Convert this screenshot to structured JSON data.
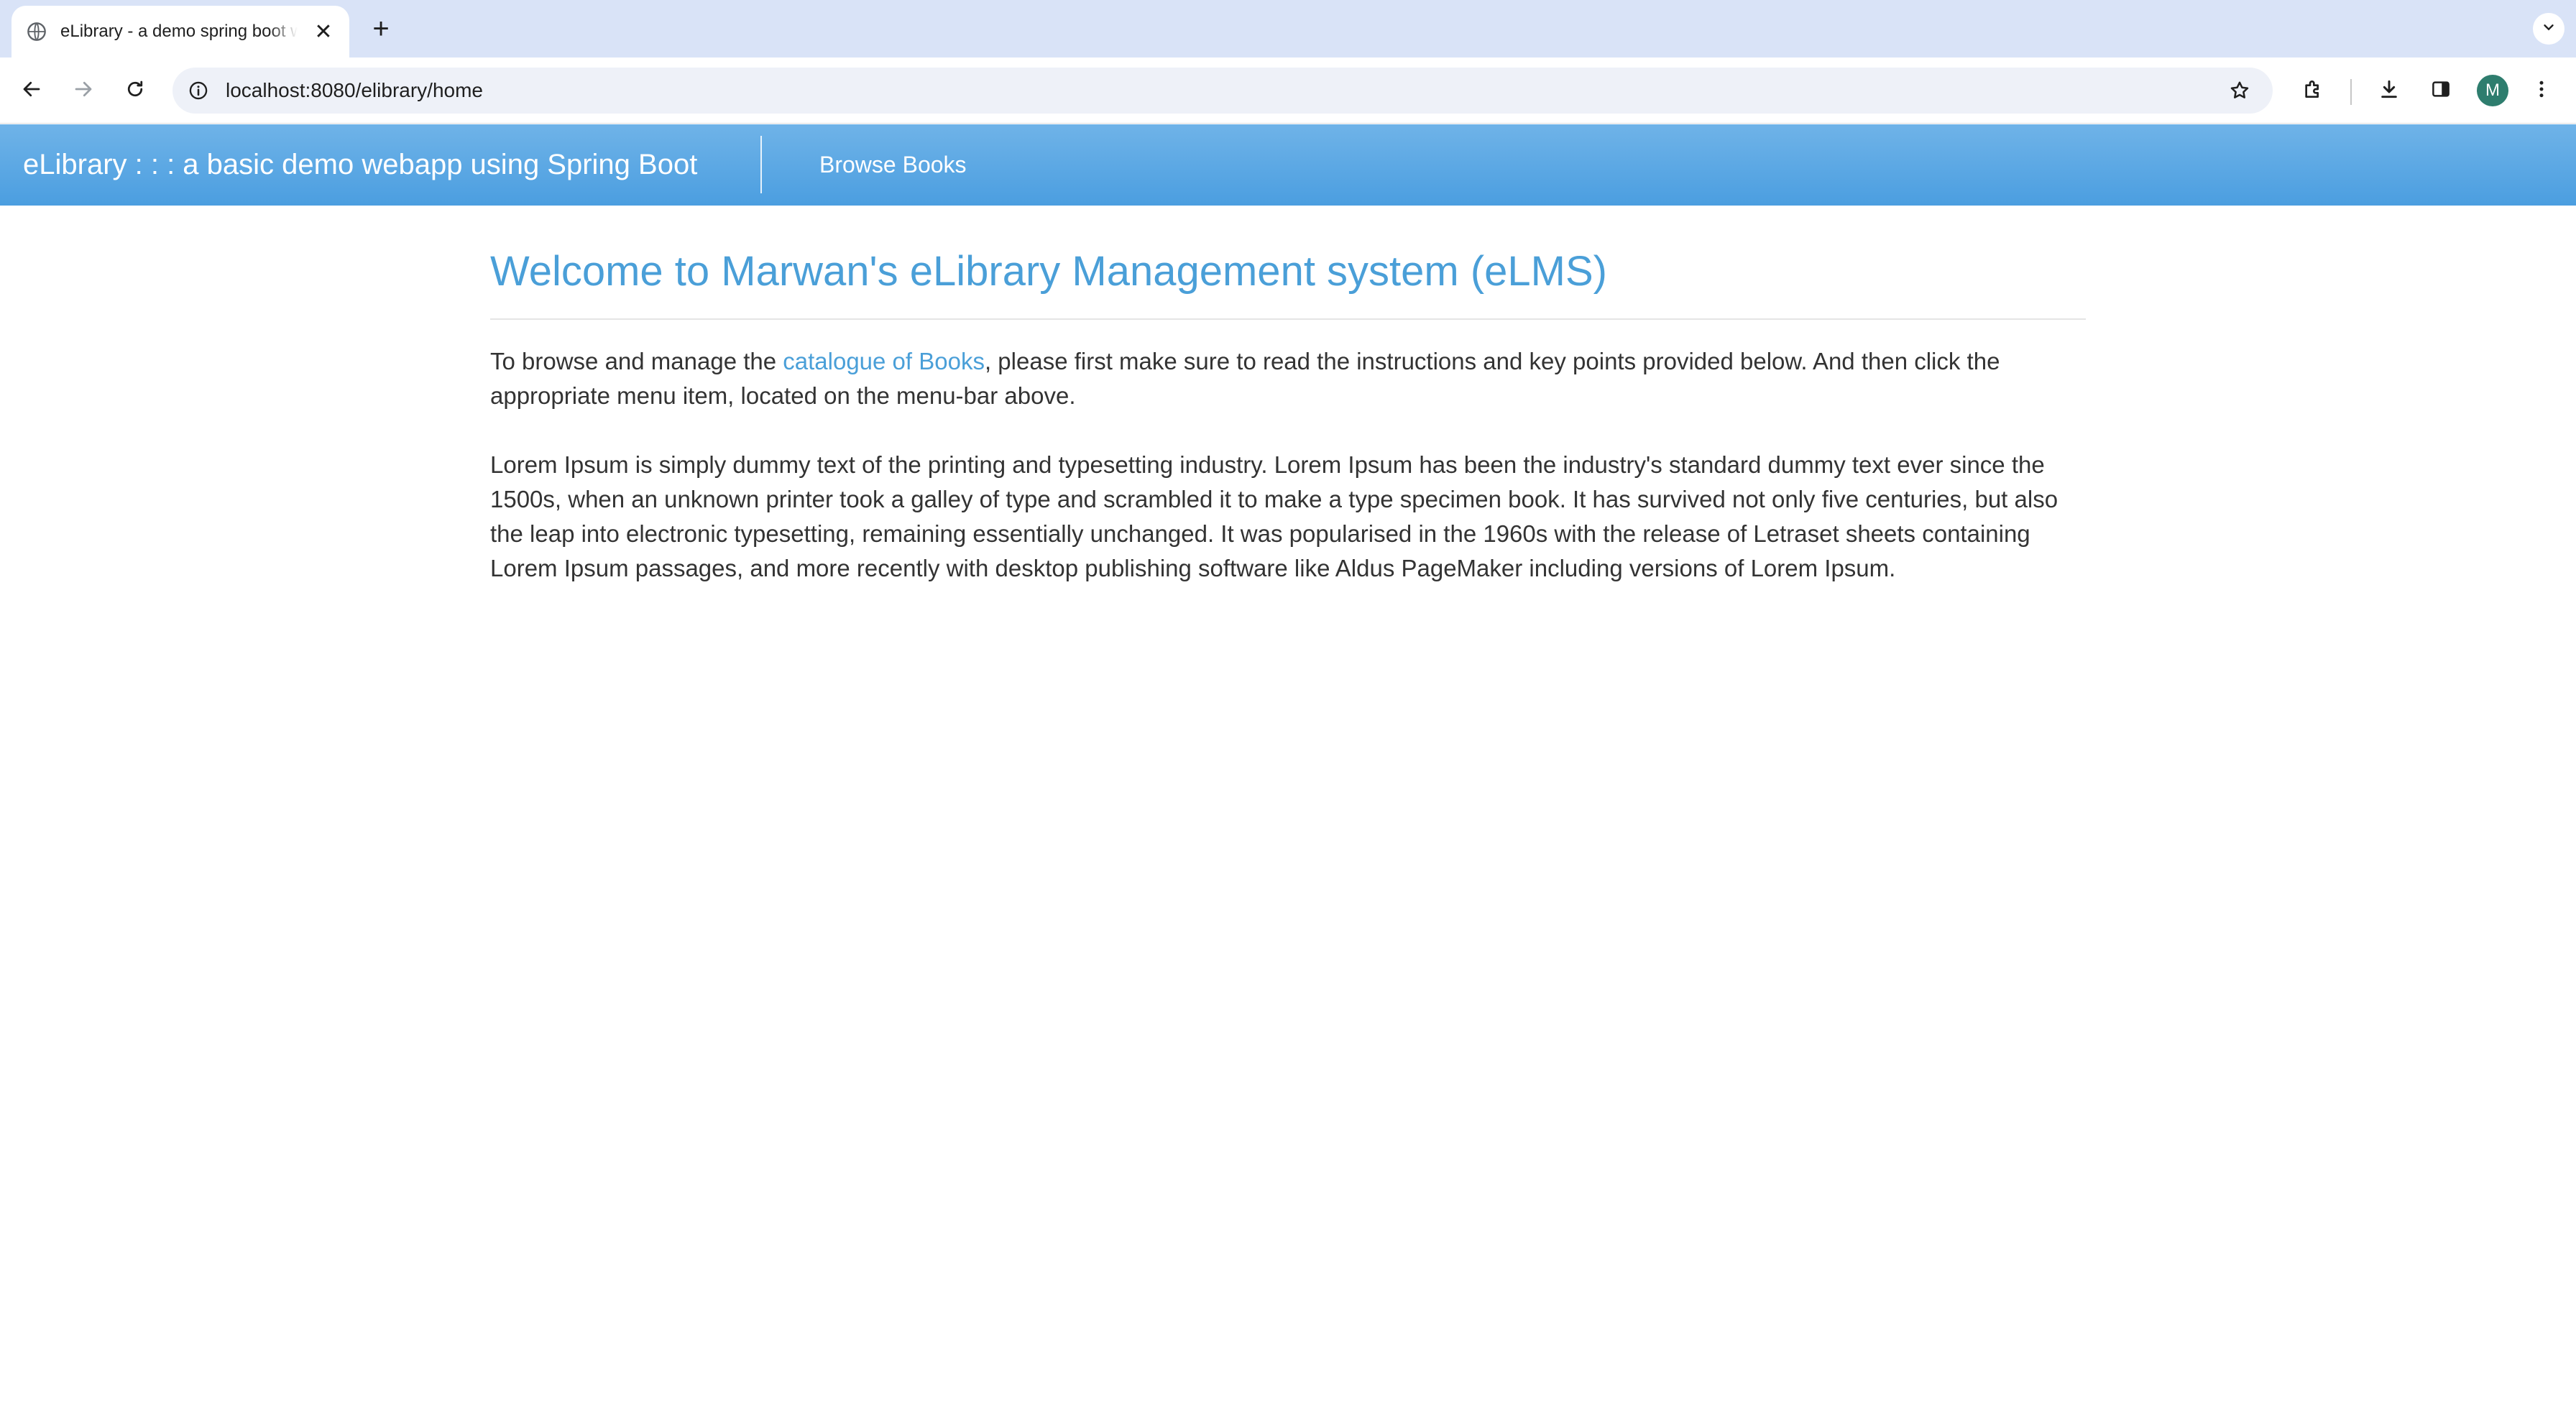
{
  "browser": {
    "tab": {
      "title": "eLibrary - a demo spring boot webapp",
      "favicon": "globe-icon",
      "close_label": "✕"
    },
    "new_tab_label": "+",
    "url": "localhost:8080/elibrary/home",
    "avatar_initial": "M"
  },
  "navbar": {
    "brand": "eLibrary : : : a basic demo webapp using Spring Boot",
    "links": [
      {
        "label": "Browse Books"
      }
    ],
    "background": "#5aa7e3"
  },
  "main": {
    "title": "Welcome to Marwan's eLibrary Management system (eLMS)",
    "intro": {
      "before_link": "To browse and manage the ",
      "link_text": "catalogue of Books",
      "after_link": ", please first make sure to read the instructions and key points provided below. And then click the appropriate menu item, located on the menu-bar above."
    },
    "lorem": "Lorem Ipsum is simply dummy text of the printing and typesetting industry. Lorem Ipsum has been the industry's standard dummy text ever since the 1500s, when an unknown printer took a galley of type and scrambled it to make a type specimen book. It has survived not only five centuries, but also the leap into electronic typesetting, remaining essentially unchanged. It was popularised in the 1960s with the release of Letraset sheets containing Lorem Ipsum passages, and more recently with desktop publishing software like Aldus PageMaker including versions of Lorem Ipsum."
  },
  "colors": {
    "accent": "#4a9fd8",
    "text": "#333333"
  }
}
